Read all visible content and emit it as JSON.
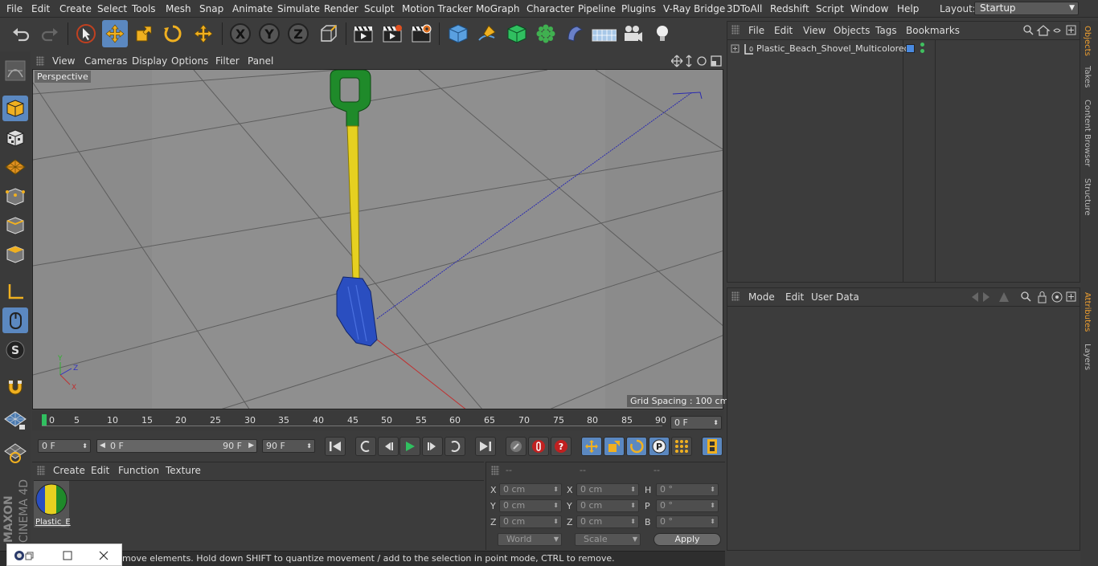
{
  "menu": [
    "File",
    "Edit",
    "Create",
    "Select",
    "Tools",
    "Mesh",
    "Snap",
    "Animate",
    "Simulate",
    "Render",
    "Sculpt",
    "Motion Tracker",
    "MoGraph",
    "Character",
    "Pipeline",
    "Plugins",
    "V-Ray Bridge",
    "3DToAll",
    "Redshift",
    "Script",
    "Window",
    "Help"
  ],
  "layout": {
    "label": "Layout:",
    "value": "Startup"
  },
  "viewport": {
    "menu": [
      "View",
      "Cameras",
      "Display",
      "Options",
      "Filter",
      "Panel"
    ],
    "label": "Perspective",
    "grid_spacing": "Grid Spacing : 100 cm"
  },
  "timeline": {
    "ticks": [
      "0",
      "5",
      "10",
      "15",
      "20",
      "25",
      "30",
      "35",
      "40",
      "45",
      "50",
      "55",
      "60",
      "65",
      "70",
      "75",
      "80",
      "85",
      "90"
    ],
    "current_frame": "0 F"
  },
  "playback": {
    "start": "0 F",
    "range_start": "0 F",
    "range_end": "90 F",
    "end": "90 F"
  },
  "materials": {
    "menu": [
      "Create",
      "Edit",
      "Function",
      "Texture"
    ],
    "items": [
      {
        "name": "Plastic_E"
      }
    ]
  },
  "coordinates": {
    "headers": [
      "--",
      "--",
      "--"
    ],
    "rows": [
      {
        "l1": "X",
        "v1": "0 cm",
        "l2": "X",
        "v2": "0 cm",
        "l3": "H",
        "v3": "0 °"
      },
      {
        "l1": "Y",
        "v1": "0 cm",
        "l2": "Y",
        "v2": "0 cm",
        "l3": "P",
        "v3": "0 °"
      },
      {
        "l1": "Z",
        "v1": "0 cm",
        "l2": "Z",
        "v2": "0 cm",
        "l3": "B",
        "v3": "0 °"
      }
    ],
    "mode": "World",
    "scale": "Scale",
    "apply": "Apply"
  },
  "objects": {
    "menu": [
      "File",
      "Edit",
      "View",
      "Objects",
      "Tags",
      "Bookmarks"
    ],
    "items": [
      {
        "name": "Plastic_Beach_Shovel_Multicolored"
      }
    ]
  },
  "attributes": {
    "menu": [
      "Mode",
      "Edit",
      "User Data"
    ]
  },
  "right_tabs": [
    "Objects",
    "Takes",
    "Content Browser",
    "Structure",
    "Attributes",
    "Layers"
  ],
  "status": "move elements. Hold down SHIFT to quantize movement / add to the selection in point mode, CTRL to remove.",
  "brand": {
    "maker": "MAXON",
    "product": "CINEMA 4D"
  },
  "colors": {
    "accent": "#5b88c0",
    "active_tab": "#f0a030",
    "axis_x": "#c03030",
    "axis_z": "#3030c0"
  }
}
